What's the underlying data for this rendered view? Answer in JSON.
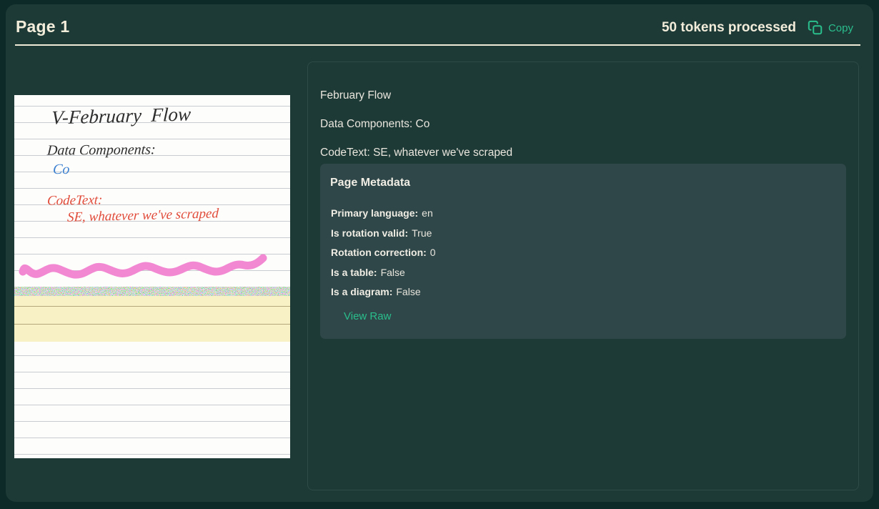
{
  "header": {
    "title": "Page 1",
    "tokens_label": "50 tokens processed",
    "copy_label": "Copy"
  },
  "note_image": {
    "lines": [
      {
        "text": "V-February  Flow",
        "ink": "black"
      },
      {
        "text": "Data Components:",
        "ink": "black"
      },
      {
        "text": "Co",
        "ink": "blue"
      },
      {
        "text": "CodeText:",
        "ink": "red"
      },
      {
        "text": "SE, whatever we've scraped",
        "ink": "red"
      }
    ],
    "squiggle_ink": "pink"
  },
  "extraction": {
    "lines": [
      "February Flow",
      "Data Components: Co",
      "CodeText: SE, whatever we've scraped"
    ]
  },
  "metadata": {
    "title": "Page Metadata",
    "fields": [
      {
        "label": "Primary language:",
        "value": "en"
      },
      {
        "label": "Is rotation valid:",
        "value": "True"
      },
      {
        "label": "Rotation correction:",
        "value": "0"
      },
      {
        "label": "Is a table:",
        "value": "False"
      },
      {
        "label": "Is a diagram:",
        "value": "False"
      }
    ],
    "view_raw_label": "View Raw"
  },
  "colors": {
    "accent_green": "#2abe8c",
    "cream_text": "#f2ecda",
    "body_text": "#e9e6dd",
    "card_bg": "#1e3a37",
    "outer_bg": "#0e2a28",
    "metadata_bg": "#2f4749",
    "ink_black": "#2e2e2e",
    "ink_blue": "#3c80d0",
    "ink_red": "#e14b3a",
    "ink_pink": "#f287d2"
  }
}
